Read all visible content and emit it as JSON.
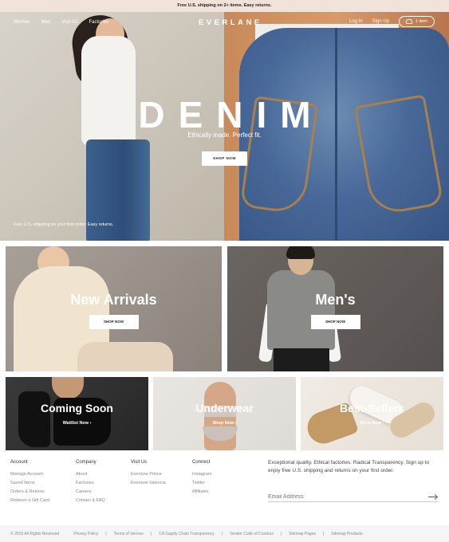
{
  "banner": {
    "text": "Free U.S. shipping on 2+ items. Easy returns."
  },
  "nav": {
    "left": [
      "Women",
      "Men",
      "Visit Us",
      "Factories"
    ],
    "logo": "EVERLANE",
    "login": "Log In",
    "signup": "Sign Up",
    "cart": "1 item"
  },
  "hero": {
    "title": "DENIM",
    "subtitle": "Ethically made. Perfect fit.",
    "button": "SHOP NOW",
    "note": "Free U.S. shipping on your first order. Easy returns."
  },
  "tiles_large": [
    {
      "title": "New Arrivals",
      "button": "SHOP NOW"
    },
    {
      "title": "Men's",
      "button": "SHOP NOW"
    }
  ],
  "tiles_small": [
    {
      "title": "Coming Soon",
      "link": "Waitlist Now  ›"
    },
    {
      "title": "Underwear",
      "link": "Shop Now  ›"
    },
    {
      "title": "Best-Sellers",
      "link": "Shop Now  ›"
    }
  ],
  "footer": {
    "account": {
      "heading": "Account",
      "links": [
        "Manage Account",
        "Saved Items",
        "Orders & Returns",
        "Redeem a Gift Card"
      ]
    },
    "company": {
      "heading": "Company",
      "links": [
        "About",
        "Factories",
        "Careers",
        "Contact & FAQ"
      ]
    },
    "visit": {
      "heading": "Visit Us",
      "links": [
        "Everlane Prince",
        "Everlane Valencia"
      ]
    },
    "connect": {
      "heading": "Connect",
      "links": [
        "Instagram",
        "Twitter",
        "Affiliates"
      ]
    },
    "about": "Exceptional quality. Ethical factories. Radical Transparency. Sign up to enjoy free U.S. shipping and returns on your first order.",
    "email_placeholder": "Email Address"
  },
  "bottom": {
    "copyright": "© 2019 All Rights Reserved",
    "links": [
      "Privacy Policy",
      "Terms of Service",
      "CA Supply Chain Transparency",
      "Vendor Code of Conduct",
      "Sitemap Pages",
      "Sitemap Products"
    ]
  }
}
